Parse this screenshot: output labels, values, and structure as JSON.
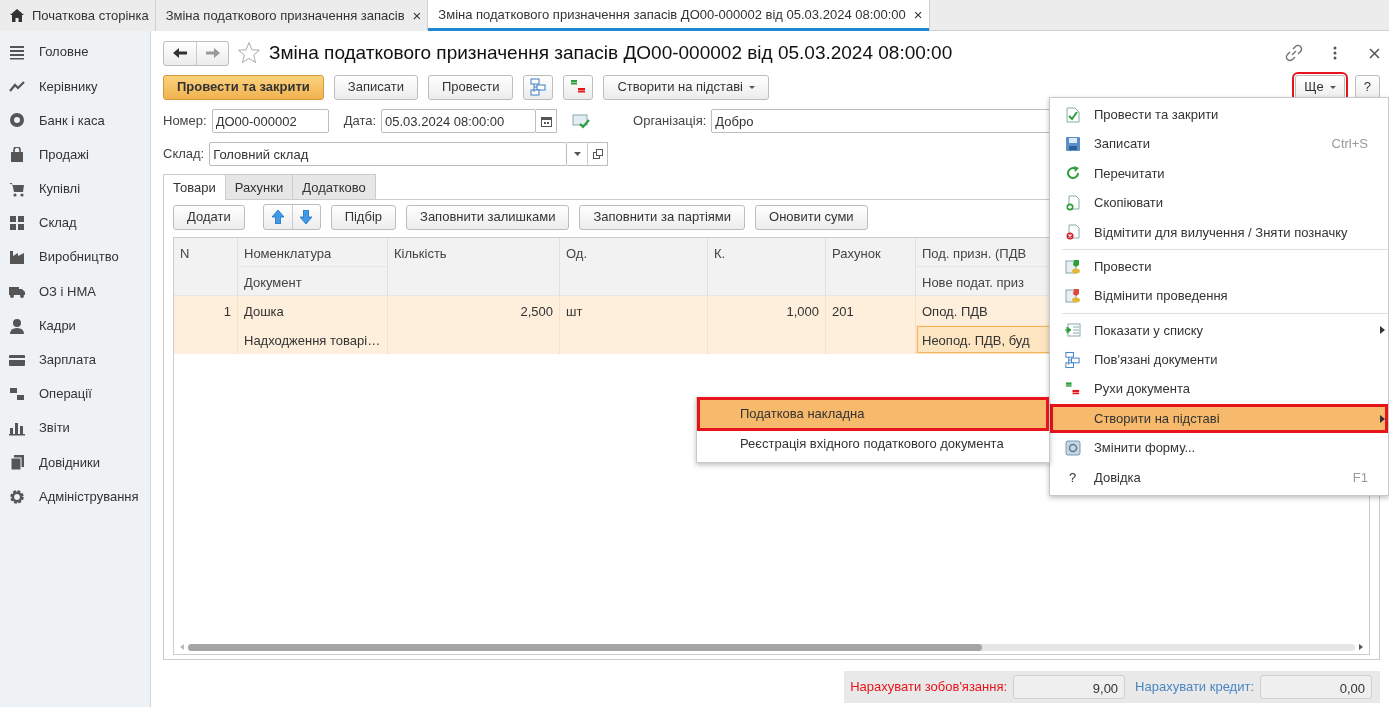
{
  "tabs": [
    {
      "label": "Початкова сторінка",
      "kind": "home",
      "selected": false
    },
    {
      "label": "Зміна податкового призначення запасів",
      "kind": "doc",
      "selected": false,
      "close": "×"
    },
    {
      "label": "Зміна податкового призначення запасів ДО00-000002 від 05.03.2024 08:00:00",
      "kind": "doc",
      "selected": true,
      "close": "×"
    }
  ],
  "sidebar": {
    "items": [
      {
        "label": "Головне",
        "kind": "menu"
      },
      {
        "label": "Керівнику",
        "kind": "chart"
      },
      {
        "label": "Банк і каса",
        "kind": "coin"
      },
      {
        "label": "Продажі",
        "kind": "bag"
      },
      {
        "label": "Купівлі",
        "kind": "cart"
      },
      {
        "label": "Склад",
        "kind": "grid"
      },
      {
        "label": "Виробництво",
        "kind": "factory"
      },
      {
        "label": "ОЗ і НМА",
        "kind": "truck"
      },
      {
        "label": "Кадри",
        "kind": "person"
      },
      {
        "label": "Зарплата",
        "kind": "card"
      },
      {
        "label": "Операції",
        "kind": "dtkt"
      },
      {
        "label": "Звіти",
        "kind": "bars"
      },
      {
        "label": "Довідники",
        "kind": "books"
      },
      {
        "label": "Адміністрування",
        "kind": "gear"
      }
    ]
  },
  "form": {
    "title": "Зміна податкового призначення запасів ДО00-000002 від 05.03.2024 08:00:00",
    "toolbar": [
      {
        "kind": "primary",
        "label": "Провести та закрити"
      },
      {
        "kind": "button",
        "label": "Записати"
      },
      {
        "kind": "button",
        "label": "Провести"
      },
      {
        "kind": "related"
      },
      {
        "kind": "postings"
      },
      {
        "kind": "dropdown",
        "label": "Створити на підставі"
      }
    ],
    "toolbar_right": [
      {
        "kind": "dropdown",
        "label": "Ще",
        "outlined": true
      },
      {
        "kind": "button",
        "label": "?",
        "outlined": false
      }
    ],
    "number": {
      "label": "Номер:",
      "value": "ДО00-000002"
    },
    "date": {
      "label": "Дата:",
      "value": "05.03.2024 08:00:00"
    },
    "organization": {
      "label": "Організація:",
      "value": "Добро"
    },
    "warehouse": {
      "label": "Склад:",
      "value": "Головний склад"
    },
    "tabs": [
      {
        "label": "Товари",
        "selected": true
      },
      {
        "label": "Рахунки",
        "selected": false
      },
      {
        "label": "Додатково",
        "selected": false
      }
    ],
    "table_toolbar": [
      {
        "kind": "button",
        "label": "Додати"
      },
      {
        "kind": "arrows"
      },
      {
        "kind": "button",
        "label": "Підбір"
      },
      {
        "kind": "button",
        "label": "Заповнити залишками"
      },
      {
        "kind": "button",
        "label": "Заповнити за партіями"
      },
      {
        "kind": "button",
        "label": "Оновити суми"
      }
    ],
    "table": {
      "columns": [
        {
          "label": "N",
          "kind": "number"
        },
        {
          "label": "Номенклатура",
          "sub": "Документ",
          "kind": "text"
        },
        {
          "label": "Кількість",
          "kind": "number"
        },
        {
          "label": "Од.",
          "kind": "text"
        },
        {
          "label": "К.",
          "kind": "number"
        },
        {
          "label": "Рахунок",
          "kind": "text"
        },
        {
          "label": "Под. призн. (ПДВ",
          "sub": "Нове подат. приз",
          "kind": "text"
        }
      ],
      "rows": [
        {
          "selected": true,
          "cells": [
            {
              "value": "1"
            },
            {
              "value": "Дошка",
              "sub": "Надходження товарі…"
            },
            {
              "value": "2,500"
            },
            {
              "value": "шт"
            },
            {
              "value": "1,000"
            },
            {
              "value": "201"
            },
            {
              "value": "Опод. ПДВ",
              "sub": "Неопод. ПДВ, буд",
              "sub_focused": true
            }
          ]
        }
      ]
    },
    "totals": [
      {
        "label": "Нарахувати зобов'язання:",
        "color": "#e8141b",
        "value": "9,00"
      },
      {
        "label": "Нарахувати кредит:",
        "color": "#4a86c0",
        "value": "0,00"
      }
    ]
  },
  "menu": {
    "groups": [
      {
        "items": [
          {
            "label": "Провести та закрити",
            "kind": "post-close",
            "selected": false,
            "submenu": false
          },
          {
            "label": "Записати",
            "kind": "save",
            "shortcut": "Ctrl+S",
            "selected": false,
            "submenu": false
          },
          {
            "label": "Перечитати",
            "kind": "refresh",
            "selected": false,
            "submenu": false
          },
          {
            "label": "Скопіювати",
            "kind": "copy",
            "selected": false,
            "submenu": false
          },
          {
            "label": "Відмітити для вилучення / Зняти позначку",
            "kind": "delete-mark",
            "selected": false,
            "submenu": false
          }
        ]
      },
      {
        "items": [
          {
            "label": "Провести",
            "kind": "post",
            "selected": false,
            "submenu": false
          },
          {
            "label": "Відмінити проведення",
            "kind": "unpost",
            "selected": false,
            "submenu": false
          }
        ]
      },
      {
        "items": [
          {
            "label": "Показати у списку",
            "kind": "list",
            "selected": false,
            "submenu": true
          },
          {
            "label": "Пов'язані документи",
            "kind": "related",
            "selected": false,
            "submenu": false
          },
          {
            "label": "Рухи документа",
            "kind": "dtkt",
            "selected": false,
            "submenu": false
          },
          {
            "label": "Створити на підставі",
            "kind": "plain",
            "selected": true,
            "outlined": true,
            "submenu": true
          },
          {
            "label": "Змінити форму...",
            "kind": "form",
            "selected": false,
            "submenu": false
          },
          {
            "label": "Довідка",
            "kind": "help",
            "icon_text": "?",
            "shortcut": "F1",
            "selected": false,
            "submenu": false
          }
        ]
      }
    ]
  },
  "submenu": {
    "items": [
      {
        "label": "Податкова накладна",
        "selected": true,
        "outlined": true
      },
      {
        "label": "Реєстрація вхідного податкового документа",
        "selected": false,
        "outlined": false
      }
    ]
  }
}
